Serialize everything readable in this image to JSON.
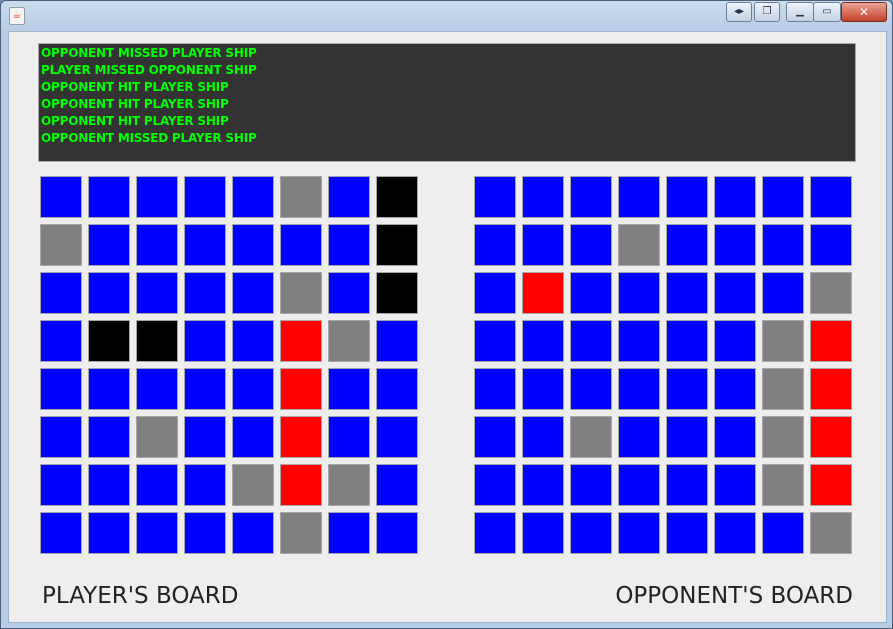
{
  "window": {
    "icon": "java-cup-icon",
    "buttons": [
      "nav-arrows-icon",
      "restore-icon",
      "minimize-icon",
      "maximize-icon",
      "close-icon"
    ]
  },
  "log": {
    "lines": [
      "OPPONENT MISSED PLAYER SHIP",
      "PLAYER MISSED OPPONENT SHIP",
      "OPPONENT HIT PLAYER SHIP",
      "OPPONENT HIT PLAYER SHIP",
      "OPPONENT HIT PLAYER SHIP",
      "OPPONENT MISSED PLAYER SHIP"
    ],
    "text_color": "#00ff00",
    "background": "#333333"
  },
  "legend_colors": {
    "water": "#0000ff",
    "ship": "#000000",
    "miss": "#808080",
    "hit": "#ff0000"
  },
  "player_board": {
    "label": "PLAYER'S BOARD",
    "rows": [
      [
        "water",
        "water",
        "water",
        "water",
        "water",
        "miss",
        "water",
        "ship"
      ],
      [
        "miss",
        "water",
        "water",
        "water",
        "water",
        "water",
        "water",
        "ship"
      ],
      [
        "water",
        "water",
        "water",
        "water",
        "water",
        "miss",
        "water",
        "ship"
      ],
      [
        "water",
        "ship",
        "ship",
        "water",
        "water",
        "hit",
        "miss",
        "water"
      ],
      [
        "water",
        "water",
        "water",
        "water",
        "water",
        "hit",
        "water",
        "water"
      ],
      [
        "water",
        "water",
        "miss",
        "water",
        "water",
        "hit",
        "water",
        "water"
      ],
      [
        "water",
        "water",
        "water",
        "water",
        "miss",
        "hit",
        "miss",
        "water"
      ],
      [
        "water",
        "water",
        "water",
        "water",
        "water",
        "miss",
        "water",
        "water"
      ]
    ]
  },
  "opponent_board": {
    "label": "OPPONENT'S BOARD",
    "rows": [
      [
        "water",
        "water",
        "water",
        "water",
        "water",
        "water",
        "water",
        "water"
      ],
      [
        "water",
        "water",
        "water",
        "miss",
        "water",
        "water",
        "water",
        "water"
      ],
      [
        "water",
        "hit",
        "water",
        "water",
        "water",
        "water",
        "water",
        "miss"
      ],
      [
        "water",
        "water",
        "water",
        "water",
        "water",
        "water",
        "miss",
        "hit"
      ],
      [
        "water",
        "water",
        "water",
        "water",
        "water",
        "water",
        "miss",
        "hit"
      ],
      [
        "water",
        "water",
        "miss",
        "water",
        "water",
        "water",
        "miss",
        "hit"
      ],
      [
        "water",
        "water",
        "water",
        "water",
        "water",
        "water",
        "miss",
        "hit"
      ],
      [
        "water",
        "water",
        "water",
        "water",
        "water",
        "water",
        "water",
        "miss"
      ]
    ]
  }
}
